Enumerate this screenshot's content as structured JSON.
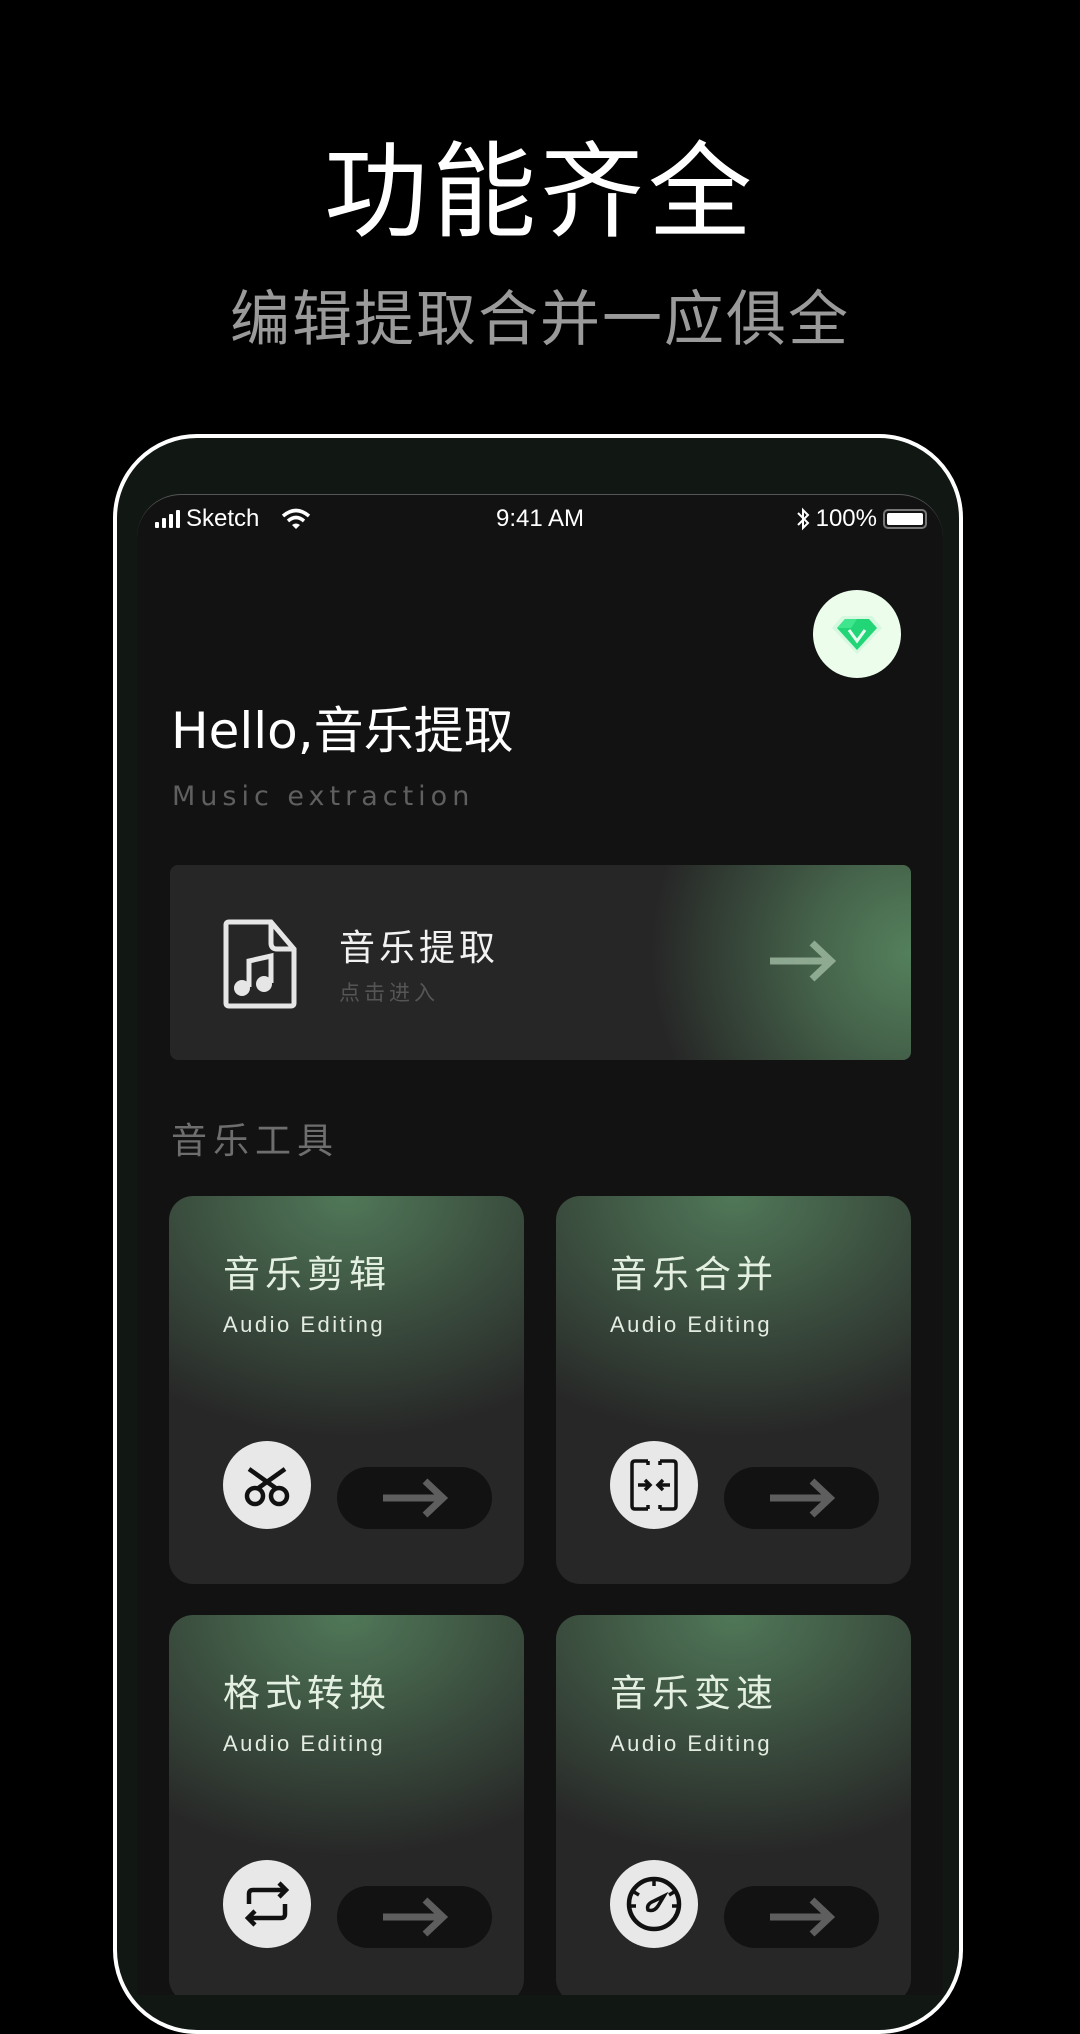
{
  "promo": {
    "title": "功能齐全",
    "subtitle": "编辑提取合并一应俱全"
  },
  "status_bar": {
    "carrier": "Sketch",
    "time": "9:41 AM",
    "battery": "100%",
    "icons": [
      "signal-icon",
      "wifi-icon",
      "bluetooth-icon",
      "battery-icon"
    ]
  },
  "header": {
    "vip_icon": "diamond-vip-icon",
    "greeting": "Hello,音乐提取",
    "greeting_sub": "Music extraction"
  },
  "extract_card": {
    "icon": "music-file-icon",
    "title": "音乐提取",
    "subtitle": "点击进入",
    "arrow_icon": "arrow-right-icon"
  },
  "section": {
    "title": "音乐工具"
  },
  "tools": [
    {
      "title": "音乐剪辑",
      "subtitle": "Audio Editing",
      "icon": "scissors-icon"
    },
    {
      "title": "音乐合并",
      "subtitle": "Audio Editing",
      "icon": "merge-icon"
    },
    {
      "title": "格式转换",
      "subtitle": "Audio Editing",
      "icon": "repeat-convert-icon"
    },
    {
      "title": "音乐变速",
      "subtitle": "Audio Editing",
      "icon": "speedometer-icon"
    }
  ],
  "colors": {
    "accent_green": "#507a58",
    "vip_green": "#1fd67a",
    "background": "#121212",
    "card": "#272727"
  }
}
